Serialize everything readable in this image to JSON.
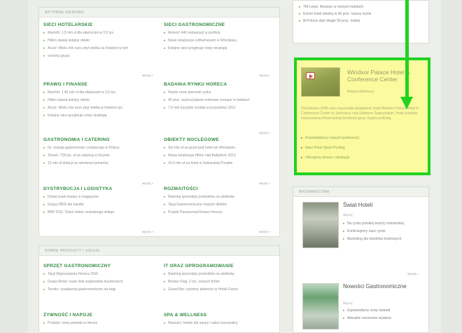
{
  "colors": {
    "accent_green": "#2f8a3e",
    "highlight_border": "#1fd31f",
    "promo_bg": "#fbfa9e"
  },
  "main_panel": {
    "header": "Aktywne kierunki",
    "more_label": "więcej »",
    "sections": [
      {
        "title": "SIECI HOTELARSKIE",
        "items": [
          "Marriott: 1,5 mln zł dla właścicieli w 3,5 tys.",
          "Hilton stawia kolejny obiekt",
          "Accor: Wielu mln euro zbyt wielka za hotelem w tym",
          "szeroka grupa"
        ]
      },
      {
        "title": "SIECI GASTRONOMICZNE",
        "items": [
          "Amrest: 440 restauracji w portfelu",
          "Nowe lokalizacje coffeeheaven w Wrocławiu",
          "Kolejne sieci przyjmuje nowy strategię"
        ]
      },
      {
        "title": "PRAWO I FINANSE",
        "items": [
          "Marriott: 1,45 mln zł dla właścicieli w 3,5 tys.",
          "Hilton stawia kolejny obiekt",
          "Accor: Wielu mln euro zbyt wielka w hotelem tys.",
          "Kolejne sieci przyjmuje nowy strategię"
        ]
      },
      {
        "title": "BADANIA RYNKU HORECA",
        "items": [
          "Hotele nowy kierunek rynku",
          "40 proc. wykorzystanie hotelowe rosnące w hotelach",
          "7,5 mln turystów zostało w przyszłości 2011"
        ]
      },
      {
        "title": "GASTRONOMIA I CATERING",
        "items": [
          "Gr. rozwija gastronomię i restauracje w Polsce",
          "Tomek: 728 tys. zł za catering w Rzymie",
          "12 mln zł dotacji na szkolenia kelnerów"
        ]
      },
      {
        "title": "OBIEKTY NOCLEGOWE",
        "items": [
          "Sto mln zł na grunt pod hotel we Wrocławiu",
          "Nowa lokalizacja Hilton nad Bałtykiem 2013",
          "14,5 mln zł na hotel w Szklarskiej Porębie"
        ]
      },
      {
        "title": "DYSTRYBUCJA I LOGISTYKA",
        "items": [
          "Dodaj nowe towary w magazynie",
          "Grupa OBIS dla handlu",
          "BBP 2011: Dzień dobór centralnego sklepu"
        ]
      },
      {
        "title": "ROZMAITOŚCI",
        "items": [
          "Ranking sprzedaży produktów na stołówkę",
          "Targi Gastronomiczne nowych tiketów",
          "Projekt Paranormal Reisen Horeca"
        ]
      }
    ]
  },
  "second_panel": {
    "header": "Dobre produkty i usługi",
    "sections": [
      {
        "title": "SPRZĘT GASTRONOMICZNY",
        "items": [
          "Targi Wyposażenia Horeca 2010",
          "Grupa Metal: nowe linie segmentów kuchennych",
          "Toretto: urządzenia gastronomiczne na targi"
        ]
      },
      {
        "title": "IT ORAZ OPROGRAMOWANIE",
        "items": [
          "Ranking sprzedaży produktów na stołówkę",
          "Booker-Flag: 2 tys. nowych firmie",
          "Grand Bar: systemy płatności w Hoteli Grand"
        ]
      },
      {
        "title": "ŻYWNOŚĆ I NAPOJE",
        "items": [
          "Produkt: nowy produkt w ofercie"
        ]
      },
      {
        "title": "SPA & WELLNESS",
        "items": [
          "Nowości: hotele dla sauny i salon komunalny"
        ]
      }
    ]
  },
  "sidebar_top_links": [
    "TM-Lewa: Nowości w nowych hotelach",
    "Komin hotel lokalny w 40 proc. lepszy wynik",
    "W Polsce zbyt drogie 50 proc. hotelu"
  ],
  "promo": {
    "title": "Windsor Palace Hotel & Conference Center",
    "subtitle": "Więcej informacji",
    "description": "Od kwietnia 2008 roku rozpoczęła działalność hotel Windsor Palace Hotel & Conference Center w Jachrance nad Zalewem Zegrzyńskim. Hotel posiada nowoczesną infrastrukturę konferencyjną i wypoczynkową.",
    "links": [
      "Przedsiębiorcy nowych konferencji",
      "Nasz Hotel Spain Posting",
      "Oferujemy biznes i rekreacje"
    ]
  },
  "magazines_panel": {
    "header": "Wydawnictwa",
    "more_label": "więcej »",
    "items": [
      {
        "title": "Świat Hoteli",
        "subtitle": "Więcej",
        "links": [
          "Na rynku polskiej branży hotelarskiej",
          "Kontrolujemy nasz rynek",
          "Marketing dla obiektów hotelowych"
        ]
      },
      {
        "title": "Nowości Gastronomiczne",
        "subtitle": "Więcej",
        "links": [
          "Zapowiadamy nowy kwartał",
          "Aktualne sezonowe wydanie"
        ]
      }
    ]
  }
}
